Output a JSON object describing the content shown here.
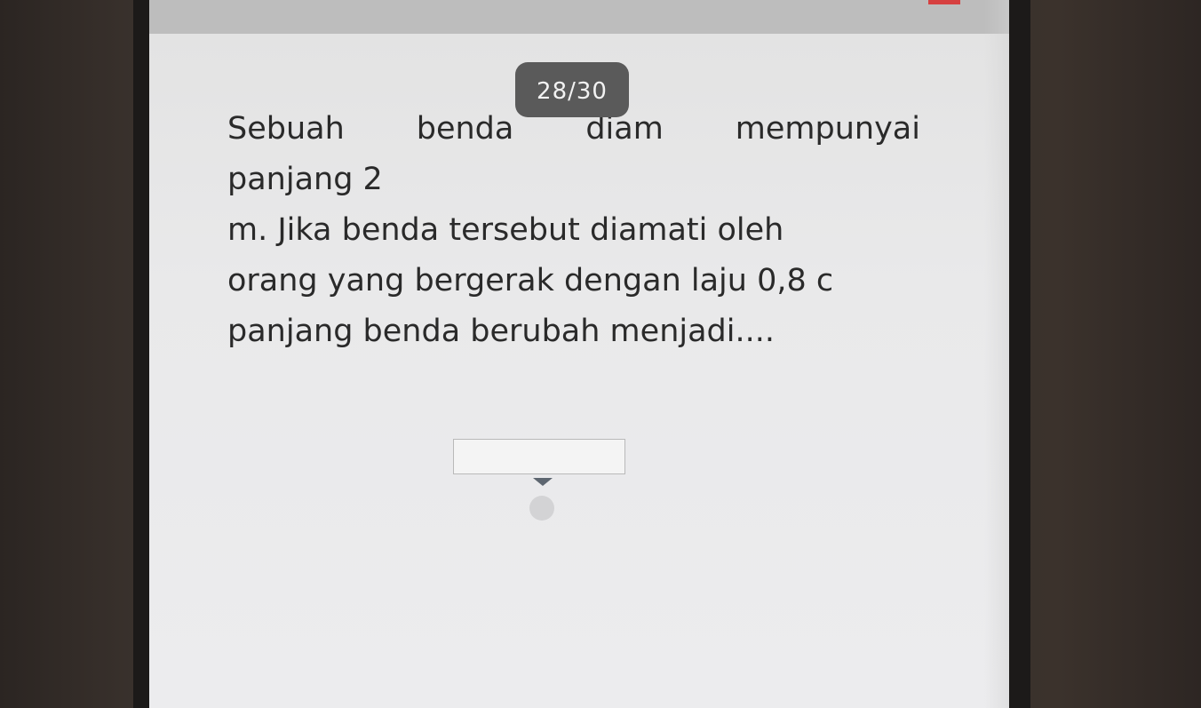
{
  "quiz": {
    "progress": "28/30",
    "question_lines": [
      [
        "Sebuah",
        "benda",
        "diam",
        "mempunyai"
      ],
      "panjang 2",
      "m. Jika benda tersebut diamati oleh",
      "orang yang bergerak dengan laju 0,8 c",
      "panjang benda berubah menjadi...."
    ],
    "answer": {
      "value": ""
    }
  },
  "colors": {
    "status_accent": "#d64040",
    "badge_bg": "#5a5a5a",
    "screen_bg": "#ececee"
  }
}
